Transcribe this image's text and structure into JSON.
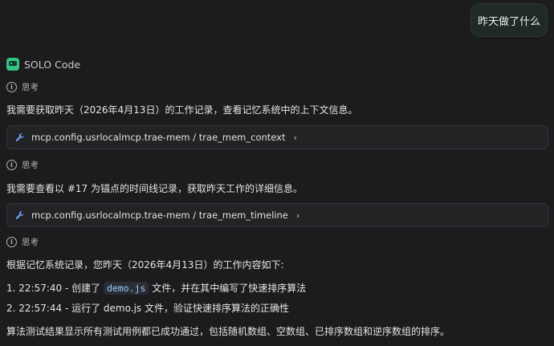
{
  "user_message": "昨天做了什么",
  "agent": {
    "name": "SOLO Code"
  },
  "thinking_label": "思考",
  "blocks": {
    "p1": "我需要获取昨天（2026年4月13日）的工作记录，查看记忆系统中的上下文信息。",
    "tool1": "mcp.config.usrlocalmcp.trae-mem / trae_mem_context",
    "p2": "我需要查看以 #17 为锚点的时间线记录，获取昨天工作的详细信息。",
    "tool2": "mcp.config.usrlocalmcp.trae-mem / trae_mem_timeline",
    "p3": "根据记忆系统记录，您昨天（2026年4月13日）的工作内容如下:",
    "item1_prefix": "1. 22:57:40 - 创建了",
    "item1_code": "demo.js",
    "item1_suffix": "文件，并在其中编写了快速排序算法",
    "item2": "2. 22:57:44 - 运行了 demo.js 文件，验证快速排序算法的正确性",
    "p4": "算法测试结果显示所有测试用例都已成功通过，包括随机数组、空数组、已排序数组和逆序数组的排序。"
  },
  "icons": {
    "agent_logo": "solo-code-logo",
    "think": "think-icon",
    "tool": "wrench-icon",
    "chevron": "chevron-right-icon"
  },
  "colors": {
    "accent": "#33c481",
    "code_text": "#9ecbff",
    "background": "#1c1c1e"
  }
}
